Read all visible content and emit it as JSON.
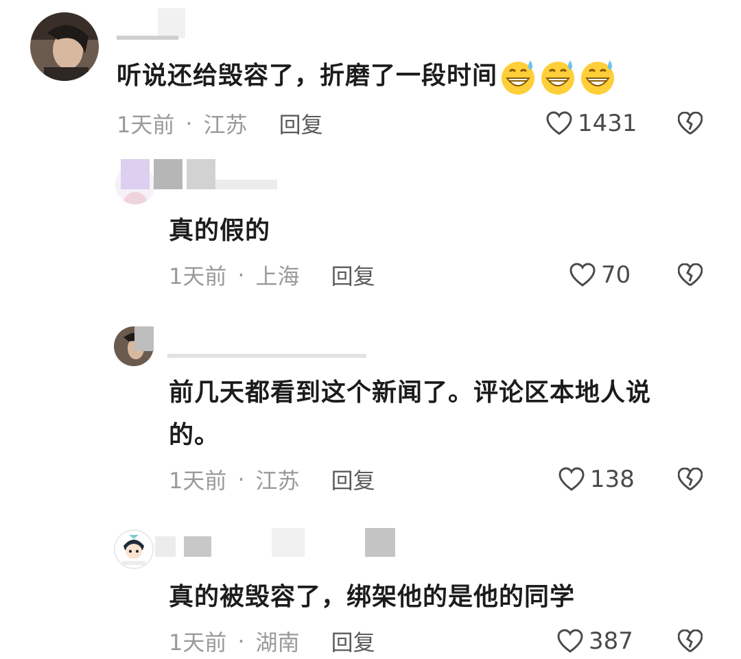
{
  "comments": [
    {
      "text": "听说还给毁容了，折磨了一段时间",
      "emojis": [
        "sweat-grin-emoji",
        "sweat-grin-emoji",
        "sweat-grin-emoji"
      ],
      "time": "1天前",
      "location": "江苏",
      "reply_label": "回复",
      "likes": "1431"
    },
    {
      "text": "真的假的",
      "time": "1天前",
      "location": "上海",
      "reply_label": "回复",
      "likes": "70"
    },
    {
      "text_line1": "前几天都看到这个新闻了。评论区本地人说",
      "text_line2": "的。",
      "time": "1天前",
      "location": "江苏",
      "reply_label": "回复",
      "likes": "138"
    },
    {
      "text": "真的被毁容了，绑架他的是他的同学",
      "time": "1天前",
      "location": "湖南",
      "reply_label": "回复",
      "likes": "387"
    }
  ],
  "separator": "·",
  "icons": {
    "like": "heart-outline-icon",
    "dislike": "broken-heart-icon"
  },
  "colors": {
    "text": "#1c1c1c",
    "meta": "#9a9a9a",
    "reply": "#5a5a5a"
  }
}
